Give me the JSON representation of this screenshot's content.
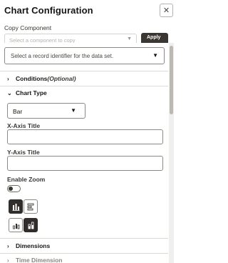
{
  "header": {
    "title": "Chart Configuration",
    "close_label": "✕"
  },
  "copy": {
    "label": "Copy Component",
    "placeholder": "Select a component to copy",
    "button_label": "Apply"
  },
  "record": {
    "placeholder": "Select a record identifier for the data set."
  },
  "sections": {
    "conditions": "Conditions",
    "conditions_note": "(Optional)",
    "chart_type": "Chart Type",
    "dimensions": "Dimensions",
    "time": "Time Dimension"
  },
  "chart_type": {
    "selected": "Bar"
  },
  "fields": {
    "x_axis_label": "X-Axis Title",
    "x_axis_value": "",
    "y_axis_label": "Y-Axis Title",
    "y_axis_value": "",
    "zoom_label": "Enable Zoom"
  },
  "states": {
    "zoom_enabled": false,
    "orientation": "vertical",
    "stacking": "stacked"
  },
  "colors": {
    "selected_bg": "#312d2a",
    "border": "#8c8984"
  }
}
